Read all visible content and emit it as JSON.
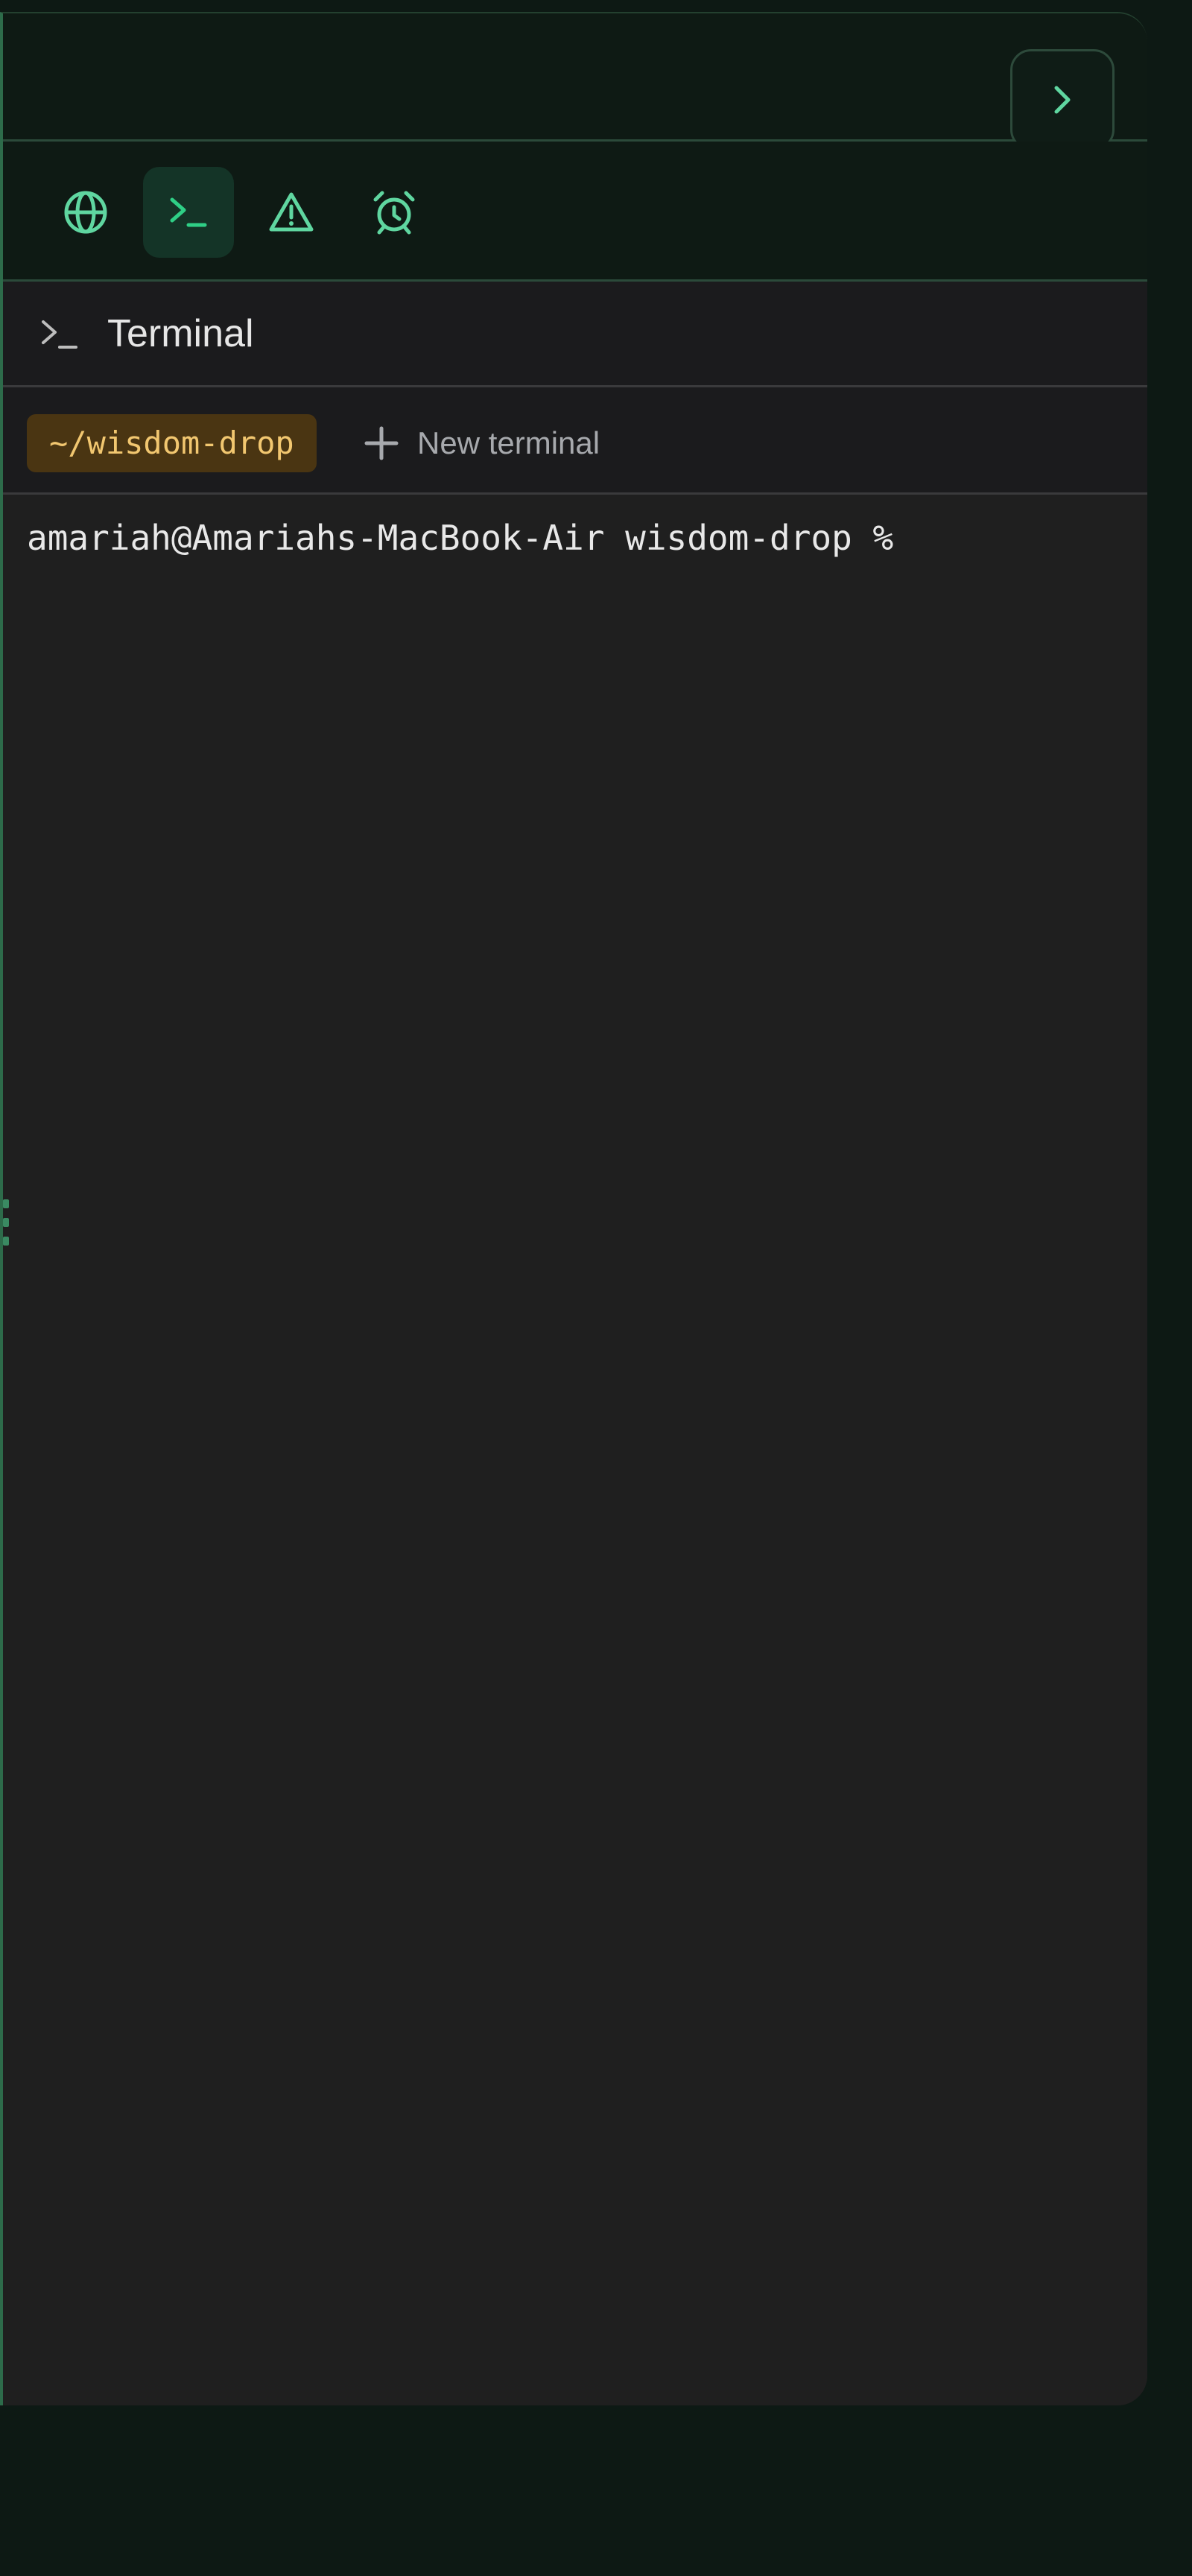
{
  "window": {
    "close_glyph": "✕",
    "collapse_icon": "chevron-right-icon"
  },
  "toolbar": {
    "tools": [
      {
        "name": "browser",
        "icon": "globe-icon",
        "active": false
      },
      {
        "name": "terminal",
        "icon": "terminal-icon",
        "active": true
      },
      {
        "name": "problems",
        "icon": "warning-icon",
        "active": false
      },
      {
        "name": "scheduled",
        "icon": "alarm-clock-icon",
        "active": false
      }
    ]
  },
  "panel": {
    "title": "Terminal",
    "title_icon": "terminal-icon"
  },
  "tabs": {
    "active_tab_label": "~/wisdom-drop",
    "new_terminal_label": "New terminal"
  },
  "terminal": {
    "prompt_line": "amariah@Amariahs-MacBook-Air wisdom-drop %"
  },
  "colors": {
    "accent": "#5fd6a0",
    "background": "#0d1914",
    "terminal_bg": "#1f1f1f",
    "tab_bg": "#4a3512",
    "tab_text": "#f2c770"
  }
}
